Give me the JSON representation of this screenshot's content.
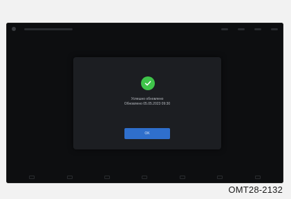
{
  "dialog": {
    "line1": "Успешно обновлено",
    "line2": "Обновлено 05.05.2023 09:30",
    "ok_label": "OK"
  },
  "caption": "OMT28-2132",
  "colors": {
    "screen_bg": "#0d0e10",
    "dialog_bg": "#1c1e22",
    "success_green": "#3fc44a",
    "button_blue": "#2f6fcc"
  },
  "icons": {
    "status": "success-check-icon"
  }
}
